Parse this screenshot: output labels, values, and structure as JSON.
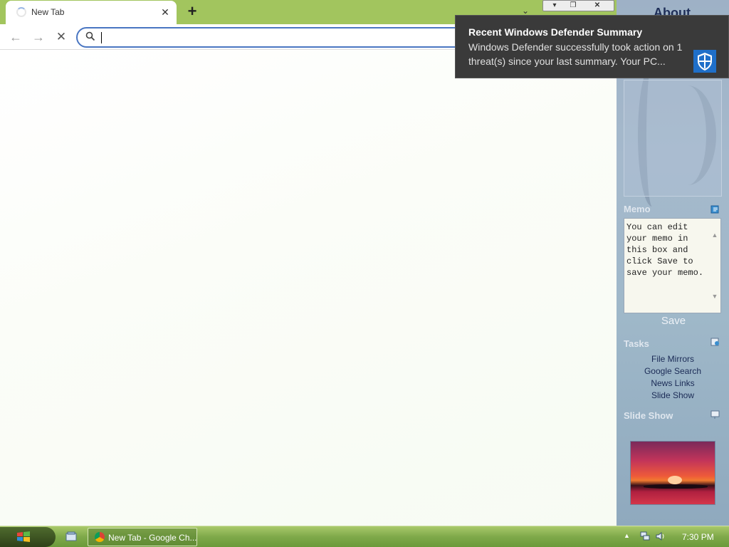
{
  "browser": {
    "tab_title": "New Tab",
    "omnibox": {
      "value": "",
      "placeholder": ""
    },
    "window_controls": {
      "minimize": "▾",
      "restore": "❐",
      "close": "✕"
    }
  },
  "sidebar": {
    "header_about": "About",
    "memo": {
      "title": "Memo",
      "text": "You can edit your memo in this box and click Save to save your memo.",
      "save_label": "Save"
    },
    "tasks": {
      "title": "Tasks",
      "items": [
        "File Mirrors",
        "Google Search",
        "News Links",
        "Slide Show"
      ]
    },
    "slideshow": {
      "title": "Slide Show"
    }
  },
  "notification": {
    "title": "Recent Windows Defender Summary",
    "body": "Windows Defender successfully took action on 1 threat(s) since your last summary. Your PC..."
  },
  "taskbar": {
    "task_button_label": "New Tab - Google Ch...",
    "clock": "7:30 PM"
  },
  "colors": {
    "tabstrip": "#a2c55e",
    "omnibox_border": "#4a76c2",
    "toast_bg": "#3a3a3a",
    "taskbar": "#7fa94a",
    "sidebar_link": "#1b2b56"
  },
  "icons": {
    "nav_back": "arrow-left-icon",
    "nav_forward": "arrow-right-icon",
    "nav_stop": "close-icon",
    "omnibox": "search-icon",
    "toast": "shield-icon",
    "start": "windows-logo-icon"
  }
}
